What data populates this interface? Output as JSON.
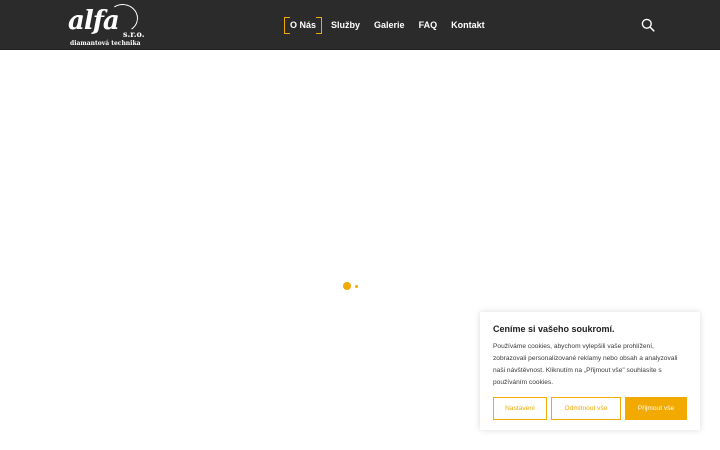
{
  "header": {
    "logo": {
      "main": "alfa",
      "suffix": "s.r.o.",
      "subtitle": "diamantová technika"
    },
    "nav": [
      {
        "label": "O Nás",
        "active": true
      },
      {
        "label": "Služby",
        "active": false
      },
      {
        "label": "Galerie",
        "active": false
      },
      {
        "label": "FAQ",
        "active": false
      },
      {
        "label": "Kontakt",
        "active": false
      }
    ],
    "search_icon": "search-icon"
  },
  "colors": {
    "header_bg": "#2b2b2b",
    "accent": "#f2a900",
    "text_dark": "#212121"
  },
  "cookie": {
    "title": "Ceníme si vašeho soukromí.",
    "text": "Používáme cookies, abychom vylepšili vaše prohlížení, zobrazovali personalizované reklamy nebo obsah a analyzovali naši návštěvnost. Kliknutím na „Přijmout vše\" souhlasíte s používáním cookies.",
    "buttons": {
      "settings": "Nastavení",
      "reject": "Odmítnout vše",
      "accept": "Přijmout vše"
    }
  }
}
